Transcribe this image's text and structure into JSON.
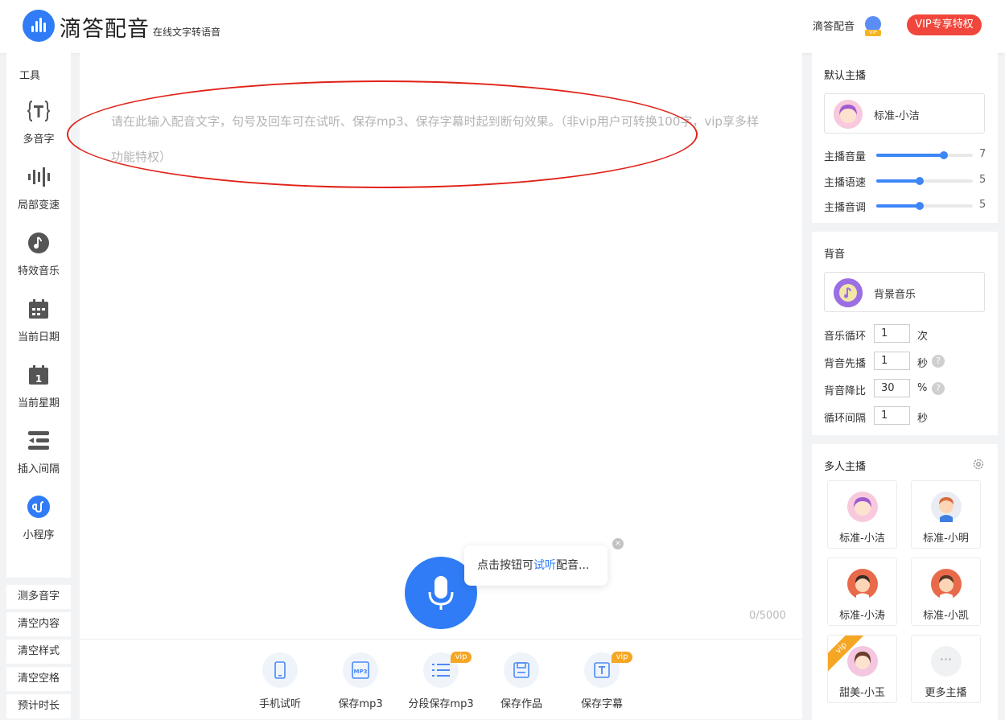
{
  "header": {
    "brand": "滴答配音",
    "tagline": "在线文字转语音",
    "user_name": "滴答配音",
    "vip_tag": "VIP",
    "vip_button": "VIP专享特权"
  },
  "tools": {
    "title": "工具",
    "items": [
      {
        "label": "多音字",
        "icon": "polyphone-icon"
      },
      {
        "label": "局部变速",
        "icon": "waveform-icon"
      },
      {
        "label": "特效音乐",
        "icon": "music-note-icon"
      },
      {
        "label": "当前日期",
        "icon": "calendar-icon"
      },
      {
        "label": "当前星期",
        "icon": "calendar-day-icon"
      },
      {
        "label": "插入间隔",
        "icon": "insert-gap-icon"
      },
      {
        "label": "小程序",
        "icon": "mini-program-icon"
      }
    ],
    "quick_actions": [
      "测多音字",
      "清空内容",
      "清空样式",
      "清空空格",
      "预计时长"
    ]
  },
  "editor": {
    "placeholder": "请在此输入配音文字，句号及回车可在试听、保存mp3、保存字幕时起到断句效果。（非vip用户可转换100字，vip享多样功能特权）",
    "counter": "0/5000",
    "tip_prefix": "点击按钮可",
    "tip_highlight": "试听",
    "tip_suffix": "配音...",
    "tip_close": "×",
    "highlight_color": "#e02218"
  },
  "actions": [
    {
      "label": "手机试听",
      "icon": "phone-icon",
      "vip": ""
    },
    {
      "label": "保存mp3",
      "icon": "mp3-file-icon",
      "vip": ""
    },
    {
      "label": "分段保存mp3",
      "icon": "list-icon",
      "vip": "vip"
    },
    {
      "label": "保存作品",
      "icon": "save-icon",
      "vip": ""
    },
    {
      "label": "保存字幕",
      "icon": "subtitle-icon",
      "vip": "vip"
    }
  ],
  "default_anchor": {
    "title": "默认主播",
    "name": "标准-小洁",
    "sliders": [
      {
        "label": "主播音量",
        "value": "7",
        "level": 0.7
      },
      {
        "label": "主播语速",
        "value": "5",
        "level": 0.45
      },
      {
        "label": "主播音调",
        "value": "5",
        "level": 0.45
      }
    ]
  },
  "background": {
    "title": "背音",
    "music_name": "背景音乐",
    "fields": [
      {
        "label": "音乐循环",
        "value": "1",
        "unit": "次",
        "help": false
      },
      {
        "label": "背音先播",
        "value": "1",
        "unit": "秒",
        "help": true
      },
      {
        "label": "背音降比",
        "value": "30",
        "unit": "%",
        "help": true
      },
      {
        "label": "循环间隔",
        "value": "1",
        "unit": "秒",
        "help": false
      }
    ],
    "help_glyph": "?"
  },
  "multi_anchor": {
    "title": "多人主播",
    "anchors": [
      {
        "name": "标准-小洁",
        "vip": ""
      },
      {
        "name": "标准-小明",
        "vip": ""
      },
      {
        "name": "标准-小涛",
        "vip": ""
      },
      {
        "name": "标准-小凯",
        "vip": ""
      },
      {
        "name": "甜美-小玉",
        "vip": "vip"
      },
      {
        "name": "更多主播",
        "vip": ""
      }
    ],
    "more_glyph": "···"
  },
  "colors": {
    "accent": "#2f7cf6",
    "vip_red": "#f0463b",
    "vip_orange": "#f5a623"
  }
}
